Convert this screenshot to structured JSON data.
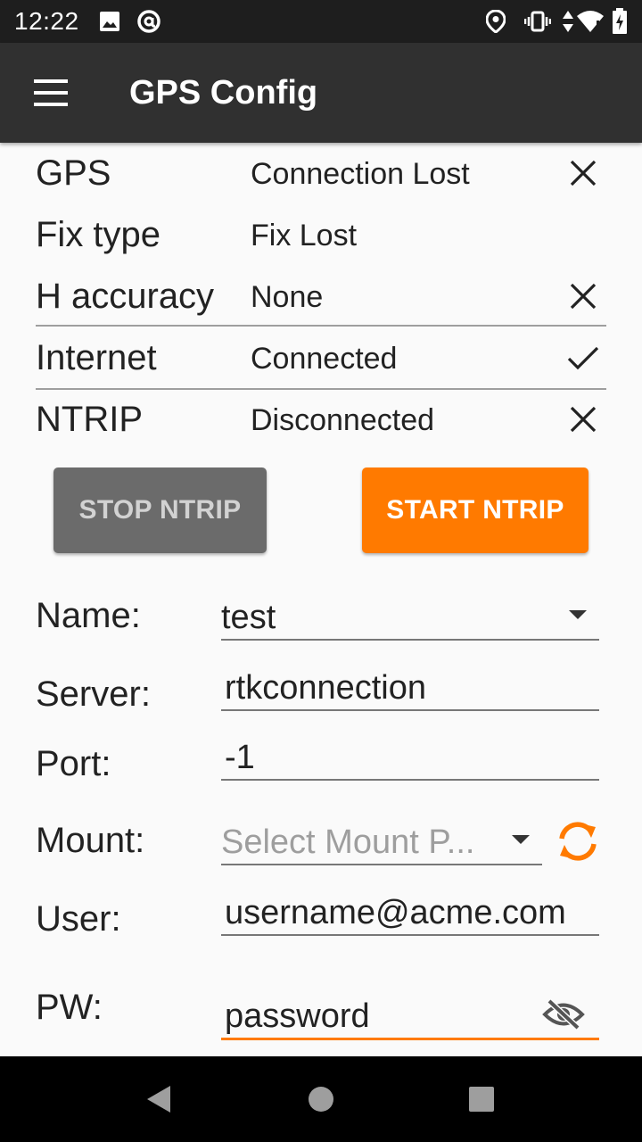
{
  "status_bar": {
    "time": "12:22",
    "icons": [
      "image-icon",
      "at-sign-icon",
      "location-icon",
      "vibrate-icon",
      "data-arrows-icon",
      "wifi-icon",
      "battery-charging-icon"
    ]
  },
  "app_bar": {
    "title": "GPS Config",
    "menu_icon": "hamburger-menu-icon"
  },
  "status": {
    "gps": {
      "label": "GPS",
      "value": "Connection Lost",
      "icon": "close-icon"
    },
    "fix_type": {
      "label": "Fix type",
      "value": "Fix Lost"
    },
    "h_accuracy": {
      "label": "H accuracy",
      "value": "None",
      "icon": "close-icon"
    },
    "internet": {
      "label": "Internet",
      "value": "Connected",
      "icon": "check-icon"
    },
    "ntrip": {
      "label": "NTRIP",
      "value": "Disconnected",
      "icon": "close-icon"
    }
  },
  "buttons": {
    "stop_ntrip": "STOP NTRIP",
    "start_ntrip": "START NTRIP"
  },
  "form": {
    "name": {
      "label": "Name:",
      "value": "test"
    },
    "server": {
      "label": "Server:",
      "value": "rtkconnection"
    },
    "port": {
      "label": "Port:",
      "value": "-1"
    },
    "mount": {
      "label": "Mount:",
      "placeholder": "Select Mount P..."
    },
    "user": {
      "label": "User:",
      "value": "username@acme.com"
    },
    "pw": {
      "label": "PW:",
      "value": "password"
    }
  },
  "colors": {
    "accent": "#ff7a00",
    "app_bar": "#303030",
    "status_bar": "#1e1e1e",
    "stop_button": "#6b6b6b"
  }
}
